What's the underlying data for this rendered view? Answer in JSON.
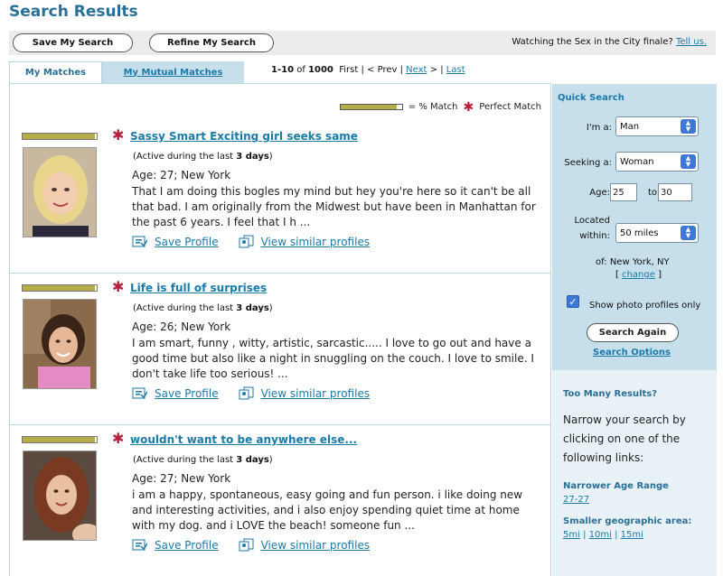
{
  "page": {
    "title": "Search Results"
  },
  "toolbar": {
    "save_label": "Save My Search",
    "refine_label": "Refine My Search",
    "watching_text": "Watching the Sex in the City finale?",
    "tell_us": "Tell us."
  },
  "tabs": {
    "my_matches": "My Matches",
    "mutual_matches": "My Mutual Matches"
  },
  "pager": {
    "range": "1-10",
    "of_label": "of",
    "total": "1000",
    "first": "First",
    "sep1": "|",
    "prev": "< Prev",
    "sep2": "|",
    "next": "Next",
    "next_arrow": ">",
    "sep3": "|",
    "last": "Last"
  },
  "legend": {
    "match_label": "= % Match",
    "perfect_label": "Perfect Match"
  },
  "profiles": [
    {
      "title": "Sassy Smart Exciting girl seeks same",
      "match": 0.98,
      "active_prefix": "(Active during the last",
      "active_value": "3 days",
      "active_suffix": ")",
      "age_location": "Age: 27; New York",
      "description": "That I am doing this bogles my mind but hey you're here so it can't be all that bad. I am originally from the Midwest but have been in Manhattan for the past 6 years. I feel that I h ...",
      "save_label": "Save Profile",
      "similar_label": "View similar profiles"
    },
    {
      "title": "Life is full of surprises",
      "match": 0.98,
      "active_prefix": "(Active during the last",
      "active_value": "3 days",
      "active_suffix": ")",
      "age_location": "Age: 26; New York",
      "description": "I am smart, funny , witty, artistic, sarcastic..... I love to go out and have a good time but also like a night in snuggling on the couch. I love to smile. I don't take life too serious! ...",
      "save_label": "Save Profile",
      "similar_label": "View similar profiles"
    },
    {
      "title": "wouldn't want to be anywhere else...",
      "match": 0.98,
      "active_prefix": "(Active during the last",
      "active_value": "3 days",
      "active_suffix": ")",
      "age_location": "Age: 27; New York",
      "description": "i am a happy, spontaneous, easy going and fun person. i like doing new and interesting activities, and i also enjoy spending quiet time at home with my dog. and i LOVE the beach! someone fun ...",
      "save_label": "Save Profile",
      "similar_label": "View similar profiles"
    }
  ],
  "quick_search": {
    "title": "Quick Search",
    "im_a_label": "I'm a:",
    "im_a_value": "Man",
    "seeking_label": "Seeking a:",
    "seeking_value": "Woman",
    "age_label": "Age:",
    "age_from": "25",
    "age_to_label": "to",
    "age_to": "30",
    "located_label_1": "Located",
    "located_label_2": "within:",
    "distance_value": "50 miles",
    "of_location": "of: New York, NY",
    "change_open": "[",
    "change_label": "change",
    "change_close": "]",
    "photo_only_label": "Show photo profiles only",
    "photo_only_checked": true,
    "search_again": "Search Again",
    "search_options": "Search Options"
  },
  "too_many": {
    "title": "Too Many Results?",
    "text": "Narrow your search by clicking on one of the following links:",
    "narrower_title": "Narrower Age Range",
    "narrower_link": "27-27",
    "smaller_title": "Smaller geographic area:",
    "geo_links": [
      "5mi",
      "10mi",
      "15mi"
    ],
    "geo_sep": "|"
  },
  "colors": {
    "accent": "#1a7aa8",
    "match_bar": "#b5ad4a",
    "star": "#b5223b",
    "sidebar": "#c6dfea"
  }
}
